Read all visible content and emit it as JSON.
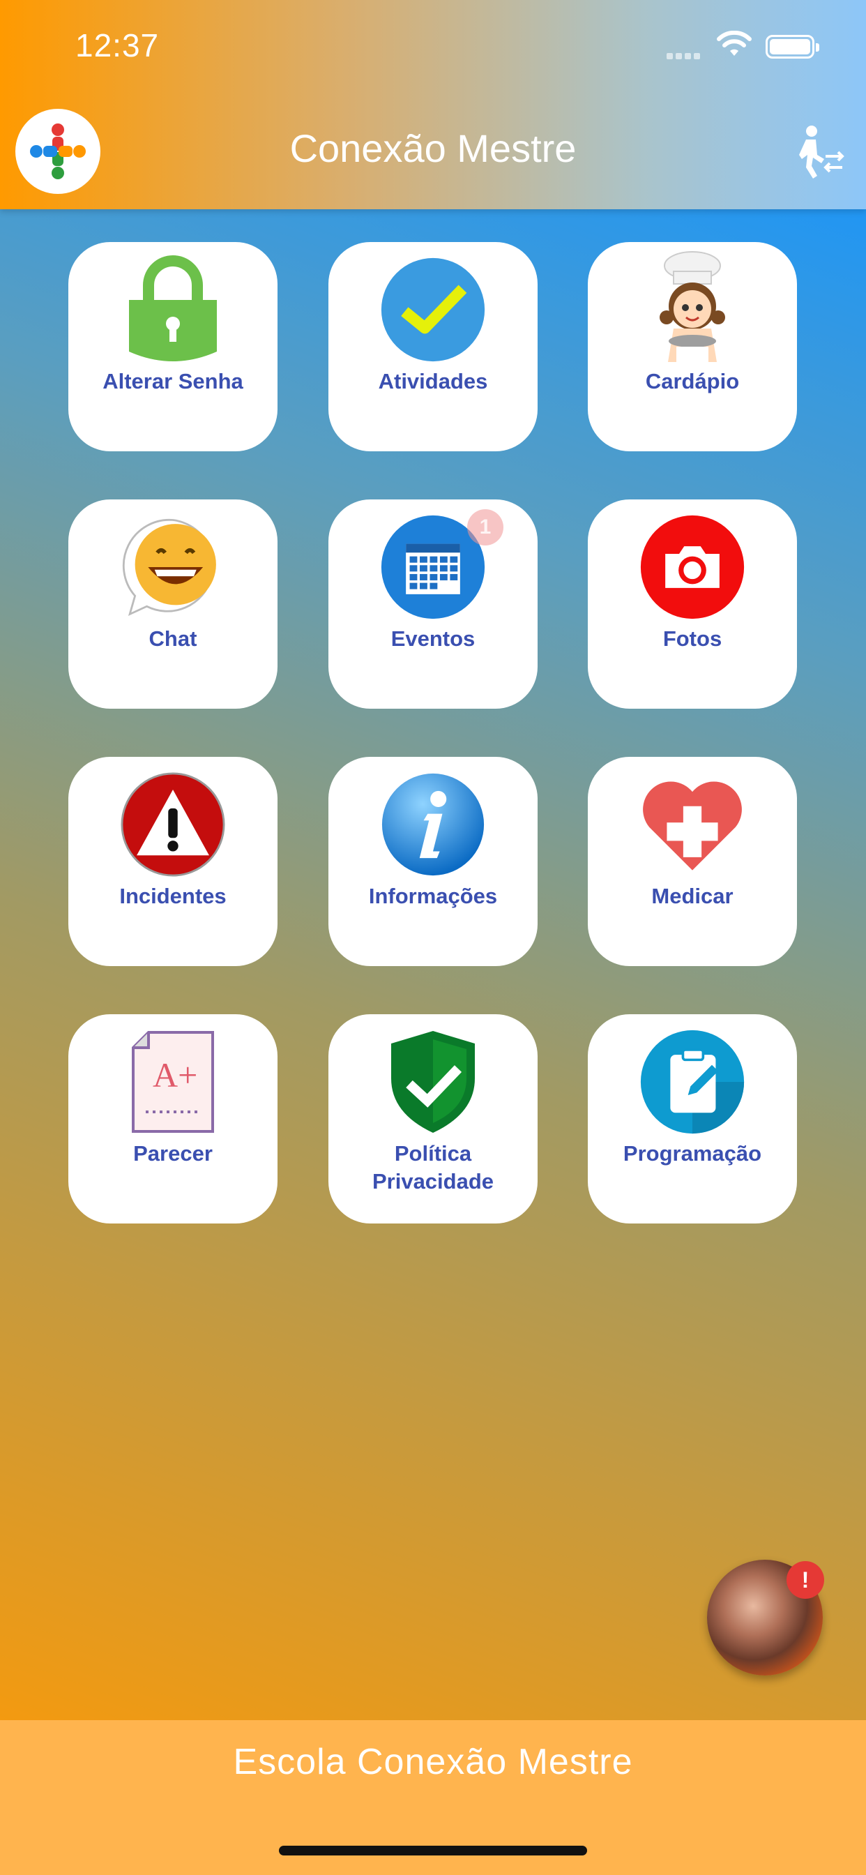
{
  "status_bar": {
    "time": "12:37"
  },
  "header": {
    "title": "Conexão Mestre"
  },
  "tiles": [
    {
      "label": "Alterar Senha",
      "icon": "padlock-icon"
    },
    {
      "label": "Atividades",
      "icon": "checkmark-icon"
    },
    {
      "label": "Cardápio",
      "icon": "chef-girl-icon"
    },
    {
      "label": "Chat",
      "icon": "smiley-chat-icon"
    },
    {
      "label": "Eventos",
      "icon": "calendar-icon",
      "badge": "1"
    },
    {
      "label": "Fotos",
      "icon": "camera-icon"
    },
    {
      "label": "Incidentes",
      "icon": "warning-icon"
    },
    {
      "label": "Informações",
      "icon": "info-icon"
    },
    {
      "label": "Medicar",
      "icon": "heart-cross-icon"
    },
    {
      "label": "Parecer",
      "icon": "graded-paper-icon"
    },
    {
      "label": "Política Privacidade",
      "icon": "shield-check-icon"
    },
    {
      "label": "Programação",
      "icon": "clipboard-edit-icon"
    }
  ],
  "floating_avatar": {
    "badge": "!"
  },
  "footer": {
    "text": "Escola Conexão Mestre"
  },
  "colors": {
    "header_start": "#ff9a00",
    "header_end": "#8dc6f8",
    "label": "#3a4fb0",
    "footer": "#ffb44e"
  }
}
